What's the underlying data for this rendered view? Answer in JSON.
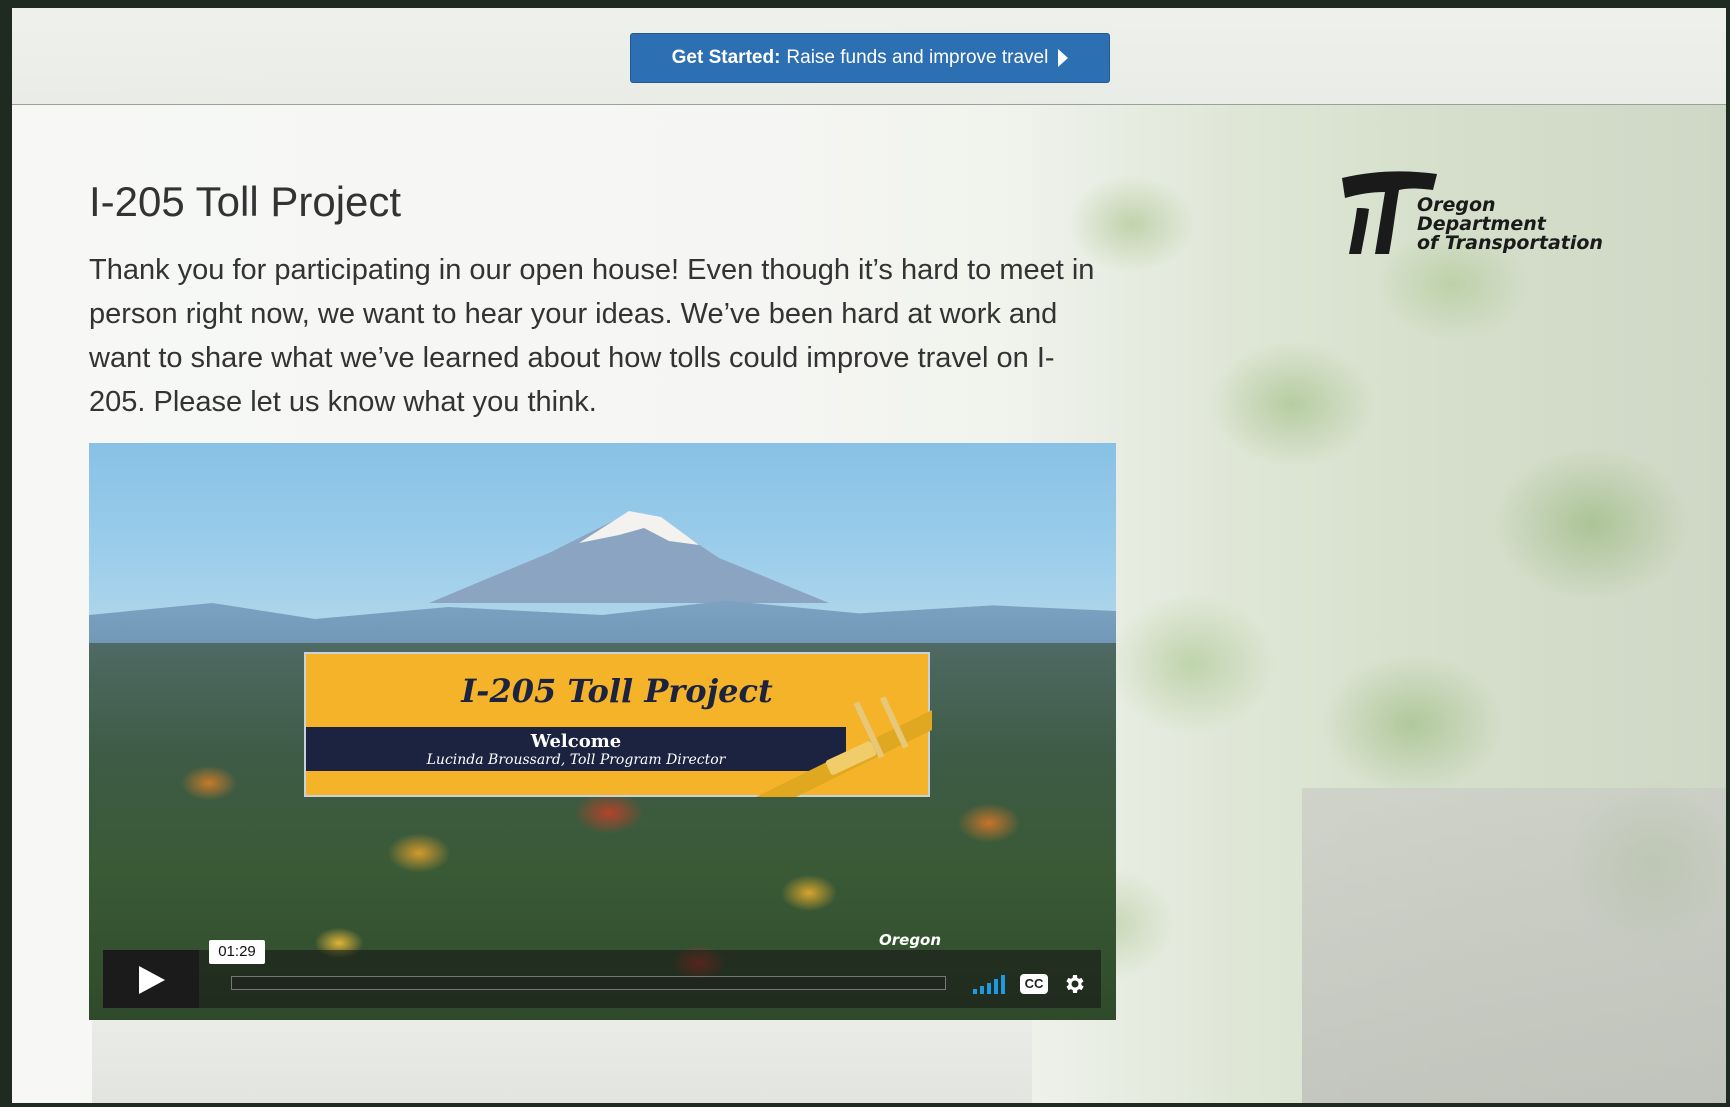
{
  "banner": {
    "cta_bold": "Get Started:",
    "cta_text": "Raise funds and improve travel"
  },
  "page": {
    "title": "I-205 Toll Project",
    "intro": "Thank you for participating in our open house! Even though it’s hard to meet in person right now, we want to hear your ideas. We’ve been hard at work and want to share what we’ve learned about how tolls could improve travel on I-205. Please let us know what you think."
  },
  "logo": {
    "line1": "Oregon",
    "line2": "Department",
    "line3": "of Transportation"
  },
  "video": {
    "slide_title": "I-205 Toll Project",
    "slide_heading": "Welcome",
    "slide_subtitle": "Lucinda Broussard, Toll Program Director",
    "watermark": "Oregon",
    "duration": "01:29",
    "cc_label": "CC"
  },
  "icons": {
    "play": "play-icon",
    "volume": "volume-icon",
    "captions": "closed-captions-icon",
    "settings": "gear-icon",
    "cta_arrow": "caret-right-icon"
  },
  "colors": {
    "cta": "#2d6fb3",
    "slide_banner": "#f5b32a",
    "slide_band": "#1c2340",
    "volume": "#1e9be0"
  }
}
